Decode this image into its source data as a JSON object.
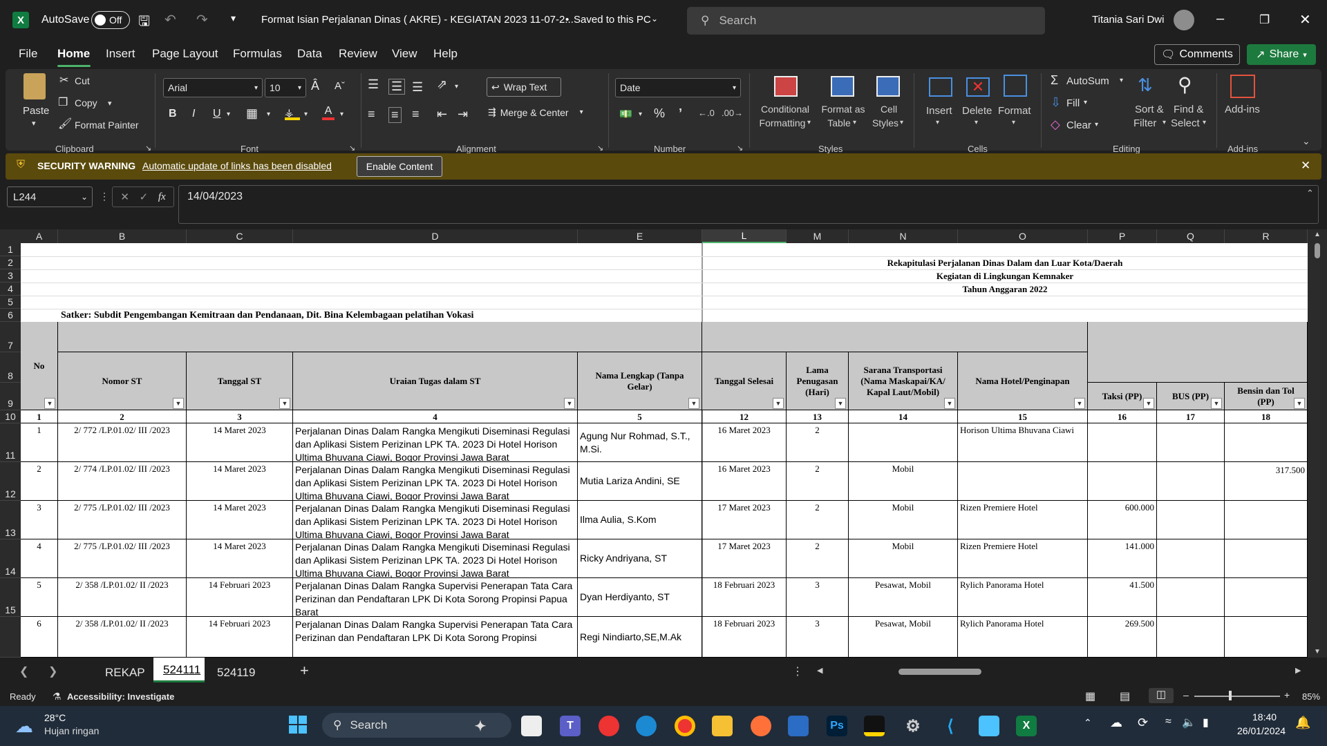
{
  "titlebar": {
    "app_letter": "X",
    "autosave_label": "AutoSave",
    "autosave_state": "Off",
    "document_title": "Format Isian Perjalanan Dinas ( AKRE) - KEGIATAN 2023 11-07-2...",
    "save_status": "Saved to this PC",
    "search_placeholder": "Search",
    "user_name": "Titania Sari Dwi"
  },
  "menu": {
    "items": [
      "File",
      "Home",
      "Insert",
      "Page Layout",
      "Formulas",
      "Data",
      "Review",
      "View",
      "Help"
    ],
    "active": "Home",
    "comments_label": "Comments",
    "share_label": "Share"
  },
  "ribbon": {
    "clipboard": {
      "paste": "Paste",
      "cut": "Cut",
      "copy": "Copy",
      "format_painter": "Format Painter",
      "group": "Clipboard"
    },
    "font": {
      "family": "Arial",
      "size": "10",
      "group": "Font"
    },
    "alignment": {
      "wrap": "Wrap Text",
      "merge": "Merge & Center",
      "group": "Alignment"
    },
    "number": {
      "format": "Date",
      "group": "Number"
    },
    "styles": {
      "conditional": "Conditional",
      "conditional2": "Formatting",
      "format_table": "Format as",
      "format_table2": "Table",
      "cell_styles": "Cell",
      "cell_styles2": "Styles",
      "group": "Styles"
    },
    "cells": {
      "insert": "Insert",
      "delete": "Delete",
      "format": "Format",
      "group": "Cells"
    },
    "editing": {
      "autosum": "AutoSum",
      "fill": "Fill",
      "clear": "Clear",
      "sort": "Sort &",
      "sort2": "Filter",
      "find": "Find &",
      "find2": "Select",
      "group": "Editing"
    },
    "addins": {
      "label": "Add-ins",
      "group": "Add-ins"
    }
  },
  "security": {
    "title": "SECURITY WARNING",
    "message": "Automatic update of links has been disabled",
    "button": "Enable Content"
  },
  "formula_bar": {
    "name_box": "L244",
    "fx": "fx",
    "value": "14/04/2023"
  },
  "sheet": {
    "columns": [
      "A",
      "B",
      "C",
      "D",
      "E",
      "L",
      "M",
      "N",
      "O",
      "P",
      "Q",
      "R"
    ],
    "selected_column": "L",
    "row_numbers": [
      "1",
      "2",
      "3",
      "4",
      "5",
      "6",
      "7",
      "8",
      "9",
      "10",
      "11",
      "12",
      "13",
      "14",
      "15"
    ],
    "report_title": [
      "Rekapitulasi Perjalanan Dinas Dalam dan Luar Kota/Daerah",
      "Kegiatan di Lingkungan Kemnaker",
      "Tahun Anggaran 2022"
    ],
    "satker": "Satker: Subdit Pengembangan Kemitraan dan Pendanaan, Dit. Bina Kelembagaan pelatihan Vokasi",
    "headers": {
      "no": "No",
      "nomor_st": "Nomor ST",
      "tanggal_st": "Tanggal ST",
      "uraian": "Uraian Tugas dalam ST",
      "nama": "Nama Lengkap (Tanpa Gelar)",
      "tanggal_selesai": "Tanggal Selesai",
      "lama": "Lama Penugasan (Hari)",
      "sarana": "Sarana Transportasi (Nama Maskapai/KA/ Kapal Laut/Mobil)",
      "hotel": "Nama Hotel/Penginapan",
      "taksi": "Taksi (PP)",
      "bus": "BUS (PP)",
      "bensin": "Bensin dan Tol (PP)"
    },
    "col_numbers": [
      "1",
      "2",
      "3",
      "4",
      "5",
      "12",
      "13",
      "14",
      "15",
      "16",
      "17",
      "18"
    ],
    "rows": [
      {
        "no": "1",
        "nomor": "2/ 772 /LP.01.02/ III /2023",
        "tgl": "14 Maret 2023",
        "uraian": "Perjalanan Dinas Dalam Rangka Mengikuti Diseminasi Regulasi dan Aplikasi Sistem Perizinan LPK TA. 2023 Di Hotel Horison Ultima Bhuvana Ciawi, Bogor Provinsi Jawa Barat",
        "nama": "Agung Nur Rohmad, S.T., M.Si.",
        "selesai": "16 Maret 2023",
        "lama": "2",
        "sarana": "",
        "hotel": "Horison Ultima Bhuvana Ciawi",
        "taksi": "",
        "bus": "",
        "bensin": ""
      },
      {
        "no": "2",
        "nomor": "2/ 774 /LP.01.02/ III /2023",
        "tgl": "14 Maret 2023",
        "uraian": "Perjalanan Dinas Dalam Rangka Mengikuti Diseminasi Regulasi dan Aplikasi Sistem Perizinan LPK TA. 2023 Di Hotel Horison Ultima Bhuvana Ciawi, Bogor Provinsi Jawa Barat",
        "nama": "Mutia Lariza Andini, SE",
        "selesai": "16 Maret 2023",
        "lama": "2",
        "sarana": "Mobil",
        "hotel": "",
        "taksi": "",
        "bus": "",
        "bensin": "317.500"
      },
      {
        "no": "3",
        "nomor": "2/ 775 /LP.01.02/ III /2023",
        "tgl": "14 Maret 2023",
        "uraian": "Perjalanan Dinas Dalam Rangka Mengikuti Diseminasi Regulasi dan Aplikasi Sistem Perizinan LPK TA. 2023 Di Hotel Horison Ultima Bhuvana Ciawi, Bogor Provinsi Jawa Barat",
        "nama": "Ilma Aulia, S.Kom",
        "selesai": "17 Maret 2023",
        "lama": "2",
        "sarana": "Mobil",
        "hotel": "Rizen Premiere Hotel",
        "taksi": "600.000",
        "bus": "",
        "bensin": ""
      },
      {
        "no": "4",
        "nomor": "2/ 775 /LP.01.02/ III /2023",
        "tgl": "14 Maret 2023",
        "uraian": "Perjalanan Dinas Dalam Rangka Mengikuti Diseminasi Regulasi dan Aplikasi Sistem Perizinan LPK TA. 2023 Di Hotel Horison Ultima Bhuvana Ciawi, Bogor Provinsi Jawa Barat",
        "nama": "Ricky Andriyana, ST",
        "selesai": "17 Maret 2023",
        "lama": "2",
        "sarana": "Mobil",
        "hotel": "Rizen Premiere Hotel",
        "taksi": "141.000",
        "bus": "",
        "bensin": ""
      },
      {
        "no": "5",
        "nomor": "2/ 358 /LP.01.02/ II /2023",
        "tgl": "14 Februari 2023",
        "uraian": "Perjalanan Dinas Dalam Rangka Supervisi Penerapan Tata Cara Perizinan dan Pendaftaran LPK Di Kota Sorong Propinsi Papua Barat",
        "nama": "Dyan Herdiyanto, ST",
        "selesai": "18 Februari 2023",
        "lama": "3",
        "sarana": "Pesawat, Mobil",
        "hotel": "Rylich Panorama Hotel",
        "taksi": "41.500",
        "bus": "",
        "bensin": ""
      },
      {
        "no": "6",
        "nomor": "2/ 358 /LP.01.02/ II /2023",
        "tgl": "14 Februari 2023",
        "uraian": "Perjalanan Dinas Dalam Rangka Supervisi Penerapan Tata Cara Perizinan dan Pendaftaran LPK Di Kota Sorong Propinsi",
        "nama": "Regi Nindiarto,SE,M.Ak",
        "selesai": "18 Februari 2023",
        "lama": "3",
        "sarana": "Pesawat, Mobil",
        "hotel": "Rylich Panorama Hotel",
        "taksi": "269.500",
        "bus": "",
        "bensin": ""
      }
    ]
  },
  "tabs": {
    "items": [
      "REKAP",
      "524111",
      "524119"
    ],
    "active": "524111"
  },
  "status": {
    "ready": "Ready",
    "accessibility": "Accessibility: Investigate",
    "zoom": "85%"
  },
  "taskbar": {
    "temp": "28°C",
    "weather": "Hujan ringan",
    "search": "Search",
    "time": "18:40",
    "date": "26/01/2024"
  }
}
